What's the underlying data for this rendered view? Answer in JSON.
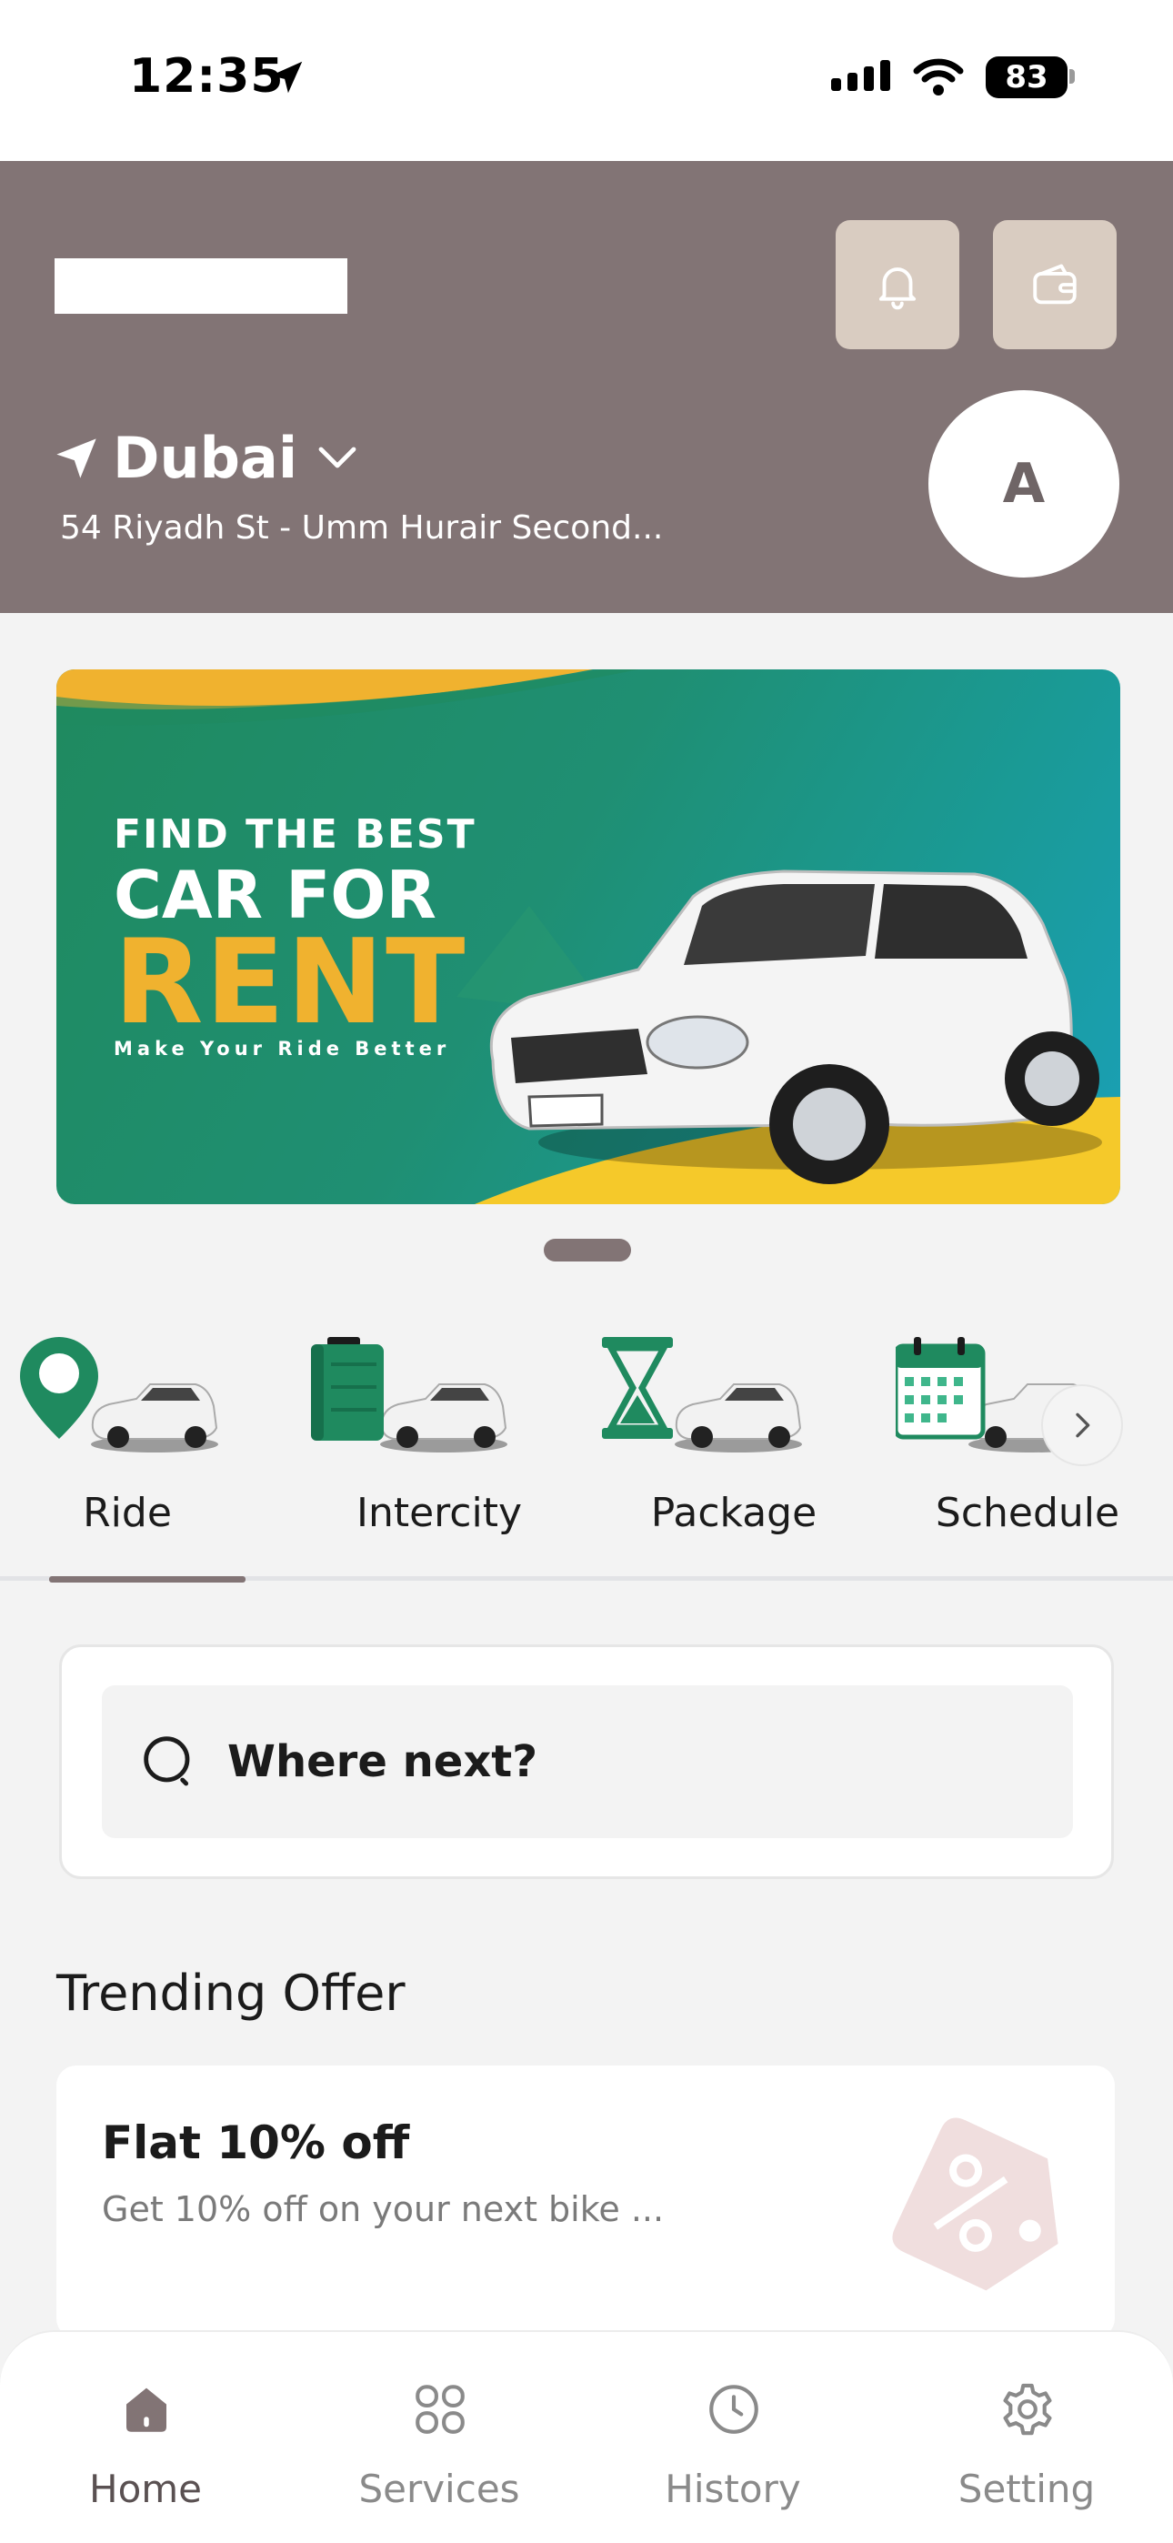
{
  "status_bar": {
    "time": "12:35",
    "battery": "83"
  },
  "header": {
    "city": "Dubai",
    "address": "54 Riyadh St - Umm Hurair Second...",
    "avatar_initial": "A"
  },
  "banner": {
    "line1": "FIND THE BEST",
    "line2": "CAR FOR",
    "line3": "RENT",
    "tagline": "Make Your Ride Better"
  },
  "services": [
    {
      "label": "Ride",
      "icon": "location-pin-car-icon"
    },
    {
      "label": "Intercity",
      "icon": "suitcase-car-icon"
    },
    {
      "label": "Package",
      "icon": "hourglass-car-icon"
    },
    {
      "label": "Schedule",
      "icon": "calendar-car-icon"
    }
  ],
  "active_service": "Ride",
  "search": {
    "placeholder": "Where next?"
  },
  "trending": {
    "title": "Trending Offer",
    "offers": [
      {
        "title": "Flat 10% off",
        "description": "Get 10% off on your next bike ..."
      }
    ]
  },
  "bottom_nav": [
    {
      "label": "Home",
      "icon": "home-icon",
      "active": true
    },
    {
      "label": "Services",
      "icon": "grid-icon",
      "active": false
    },
    {
      "label": "History",
      "icon": "clock-icon",
      "active": false
    },
    {
      "label": "Setting",
      "icon": "gear-icon",
      "active": false
    }
  ],
  "colors": {
    "header_bg": "#827475",
    "header_button_bg": "#d9ccc1",
    "banner_accent": "#f0b22f",
    "banner_green": "#1f8a5f",
    "icon_green": "#1f8a5f"
  }
}
